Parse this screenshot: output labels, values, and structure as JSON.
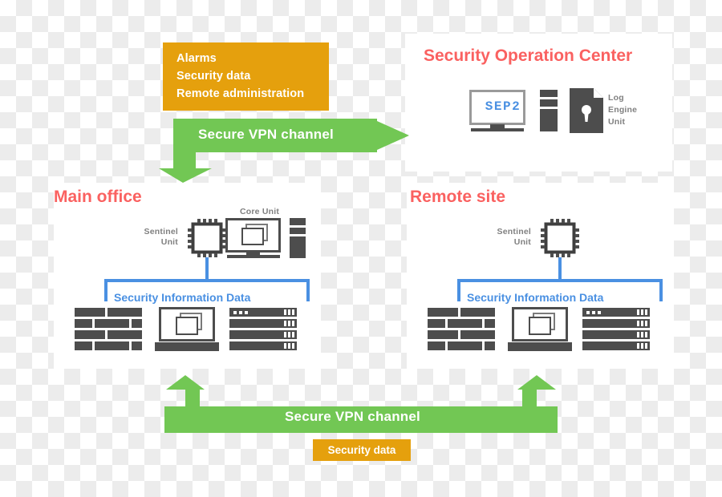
{
  "diagram": {
    "title_color": "#fa6160",
    "accent_green": "#72c койка"
  },
  "annotations": {
    "alarms_box": {
      "lines": [
        "Alarms",
        "Security data",
        "Remote administration"
      ],
      "color": "#e5a00d"
    },
    "security_data_box": {
      "label": "Security data",
      "color": "#e5a00d"
    },
    "vpn_top": {
      "label": "Secure VPN channel",
      "color": "#72c754"
    },
    "vpn_bottom": {
      "label": "Secure VPN channel",
      "color": "#72c754"
    }
  },
  "soc_panel": {
    "title": "Security Operation Center",
    "monitor_text": "SEP2",
    "log_engine_label": [
      "Log",
      "Engine",
      "Unit"
    ]
  },
  "main_office": {
    "title": "Main office",
    "sentinel_label": [
      "Sentinel",
      "Unit"
    ],
    "core_label": "Core Unit",
    "data_label": "Security Information Data"
  },
  "remote_site": {
    "title": "Remote site",
    "sentinel_label": [
      "Sentinel",
      "Unit"
    ],
    "data_label": "Security Information Data"
  },
  "icons": {
    "chip": "chip-icon",
    "monitor": "monitor-icon",
    "tower": "tower-icon",
    "laptop": "laptop-icon",
    "firewall": "firewall-brick-icon",
    "server_rack": "server-rack-icon",
    "lock_document": "lock-document-icon"
  }
}
